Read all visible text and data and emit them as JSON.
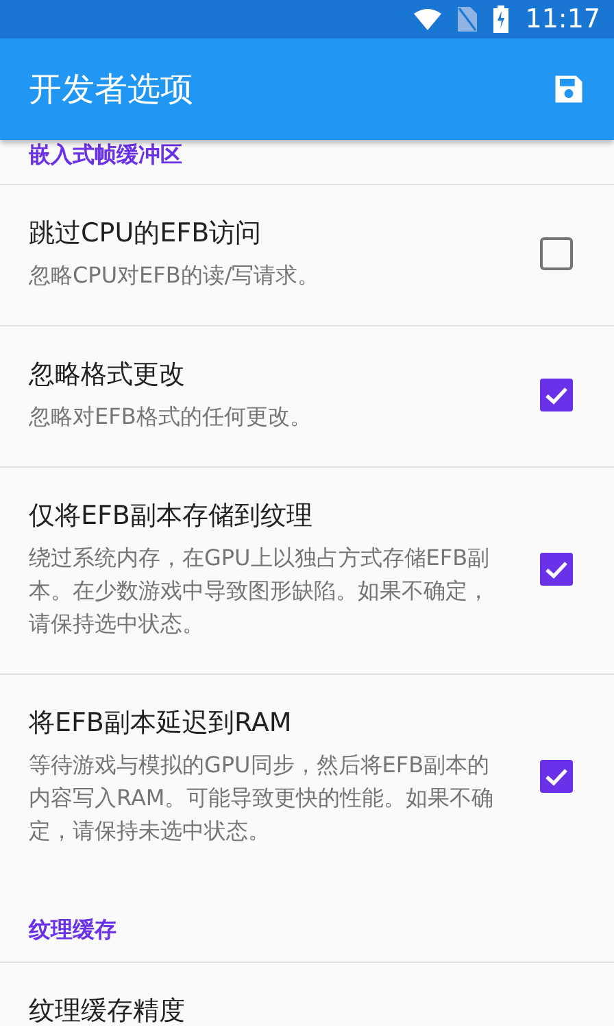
{
  "status_bar": {
    "time": "11:17"
  },
  "app_bar": {
    "title": "开发者选项"
  },
  "sections": [
    {
      "header": "嵌入式帧缓冲区",
      "items": [
        {
          "kind": "checkbox",
          "title": "跳过CPU的EFB访问",
          "summary": "忽略CPU对EFB的读/写请求。",
          "checked": false
        },
        {
          "kind": "checkbox",
          "title": "忽略格式更改",
          "summary": "忽略对EFB格式的任何更改。",
          "checked": true
        },
        {
          "kind": "checkbox",
          "title": "仅将EFB副本存储到纹理",
          "summary": "绕过系统内存，在GPU上以独占方式存储EFB副本。在少数游戏中导致图形缺陷。如果不确定，请保持选中状态。",
          "checked": true
        },
        {
          "kind": "checkbox",
          "title": "将EFB副本延迟到RAM",
          "summary": "等待游戏与模拟的GPU同步，然后将EFB副本的内容写入RAM。可能导致更快的性能。如果不确定，请保持未选中状态。",
          "checked": true
        }
      ]
    },
    {
      "header": "纹理缓存",
      "items": [
        {
          "kind": "setting",
          "title": "纹理缓存精度"
        }
      ]
    }
  ]
}
